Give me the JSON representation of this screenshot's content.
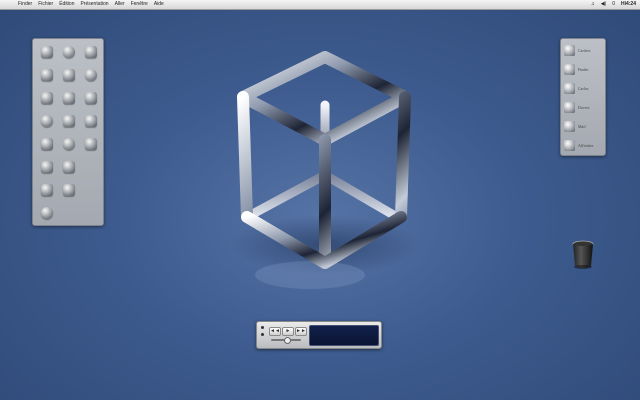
{
  "menubar": {
    "apple_symbol": "",
    "menus": [
      "Finder",
      "Fichier",
      "Édition",
      "Présentation",
      "Aller",
      "Fenêtre",
      "Aide"
    ],
    "status_icons": [
      "music-note-icon",
      "volume-icon"
    ],
    "battery": "0",
    "clock": "Hi4:24"
  },
  "left_panel": {
    "icons": [
      "tool-icon",
      "sphere-icon",
      "satellite-icon",
      "gear-icon",
      "bug-icon",
      "magnifier-icon",
      "app-icon",
      "globe-icon",
      "pen-icon",
      "tool2-icon",
      "camera-icon",
      "brush-icon",
      "refresh-icon",
      "lock-icon",
      "pen-tablet-icon",
      "disk-icon",
      "stack-icon",
      "",
      "music-icon",
      "compass-icon",
      "",
      "drive-icon",
      "",
      ""
    ]
  },
  "right_panel": {
    "items": [
      {
        "icon": "network-icon",
        "label": "Carities"
      },
      {
        "icon": "finder-icon",
        "label": "Finder"
      },
      {
        "icon": "user-icon",
        "label": "Carlos"
      },
      {
        "icon": "music-icon",
        "label": "Dovers"
      },
      {
        "icon": "envelope-icon",
        "label": "Mail"
      },
      {
        "icon": "globe-icon",
        "label": "Affinities"
      }
    ]
  },
  "desktop": {
    "centerpiece": "chrome-cube",
    "trash_icon": "trash-icon"
  },
  "itunes_widget": {
    "prev": "◄◄",
    "play": "►",
    "next": "►►",
    "display_symbol": "",
    "volume_level": 0.5
  },
  "colors": {
    "desktop": "#3d5b8e",
    "menubar": "#e6e6e6",
    "panel": "#b0b4bb",
    "itunes_display": "#0f1b42",
    "apple_blue": "#66a8f0"
  }
}
